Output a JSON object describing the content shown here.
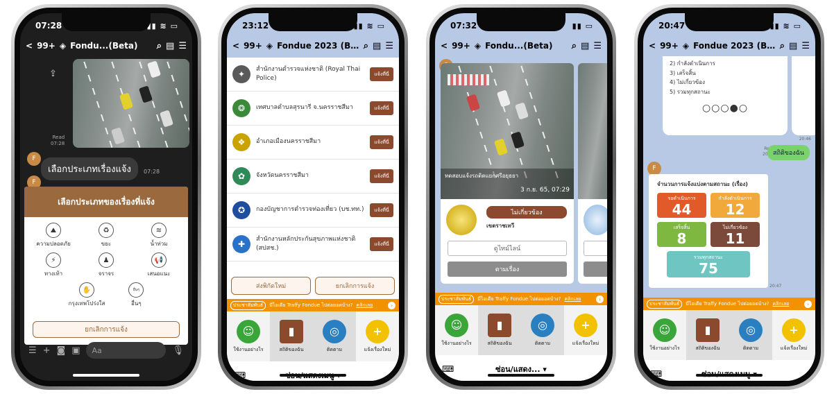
{
  "phone1": {
    "time": "07:28",
    "signal": "▮▮ ≋ ▭",
    "nav": {
      "back": "<",
      "count": "99+",
      "title": "Fondu...(Beta)"
    },
    "read": {
      "status": "Read",
      "time": "07:28"
    },
    "message": "เลือกประเภทเรื่องแจ้ง",
    "message_time": "07:28",
    "card_title": "เลือกประเภทของเรื่องที่แจ้ง",
    "categories": [
      {
        "label": "ความปลอดภัย",
        "icon": "⛰"
      },
      {
        "label": "ขยะ",
        "icon": "♻"
      },
      {
        "label": "น้ำท่วม",
        "icon": "≋"
      },
      {
        "label": "ทางเท้า",
        "icon": "⚡"
      },
      {
        "label": "จราจร",
        "icon": "♟"
      },
      {
        "label": "เสนอแนะ",
        "icon": "📢"
      },
      {
        "label": "กรุงเทพโปร่งใส",
        "icon": "✋"
      },
      {
        "label": "อื่นๆ",
        "icon": "อื่นๆ"
      }
    ],
    "cancel": "ยกเลิกการแจ้ง",
    "input_placeholder": "Aa"
  },
  "phone2": {
    "time": "23:12",
    "signal": "▮▮ ≋ ▭",
    "nav": {
      "back": "<",
      "count": "99+",
      "title": "Fondue 2023 (Beta)"
    },
    "agencies": [
      {
        "name": "สำนักงานตำรวจแห่งชาติ (Royal Thai Police)",
        "btn": "แจ้งที่นี่",
        "color": "#5a5a5a"
      },
      {
        "name": "เทศบาลตำบลสุรนารี จ.นครราชสีมา",
        "btn": "แจ้งที่นี่",
        "color": "#3a8a3a"
      },
      {
        "name": "อำเภอเมืองนครราชสีมา",
        "btn": "แจ้งที่นี่",
        "color": "#c9a300"
      },
      {
        "name": "จังหวัดนครราชสีมา",
        "btn": "แจ้งที่นี่",
        "color": "#2e8b57"
      },
      {
        "name": "กองบัญชาการตำรวจท่องเที่ยว (บช.ทท.)",
        "btn": "แจ้งที่นี่",
        "color": "#1f4e9e"
      },
      {
        "name": "สำนักงานหลักประกันสุขภาพแห่งชาติ (สปสช.)",
        "btn": "แจ้งที่นี่",
        "color": "#2a72c8"
      }
    ],
    "send_new": "ส่งพิกัดใหม่",
    "cancel": "ยกเลิกการแจ้ง",
    "promo": {
      "badge": "ประชาสัมพันธ์",
      "text": "มีไอเดีย Traffy Fondue ไปต่อยอดบ้าง?",
      "link": "คลิกเลย"
    },
    "tabs": [
      {
        "label": "ใช้งานอย่างไร",
        "icon": "☺",
        "color": "#3aa63a"
      },
      {
        "label": "สถิติของฉัน",
        "icon": "▮",
        "color": "#8b4a2e"
      },
      {
        "label": "ติดตาม",
        "icon": "◎",
        "color": "#2a7fc0"
      },
      {
        "label": "แจ้งเรื่องใหม่",
        "icon": "+",
        "color": "#f2c200"
      }
    ],
    "menu_toggle": "ซ่อน/แสดงเมนู ▾"
  },
  "phone3": {
    "time": "07:32",
    "signal": "▮▮ ▭",
    "nav": {
      "back": "<",
      "count": "99+",
      "title": "Fondu...(Beta)"
    },
    "caption": "ทดสอบแจ้งรถติดแยกศรีอยุธยา",
    "date": "3 ก.ย. 65, 07:29",
    "status": "ไม่เกี่ยวข้อง",
    "district": "เขตราชเทวี",
    "view_timeline": "ดูไทม์ไลน์",
    "follow": "ตามเรื่อง",
    "promo": {
      "badge": "ประชาสัมพันธ์",
      "text": "มีไอเดีย Traffy Fondue ไปต่อยอดบ้าง?",
      "link": "คลิกเลย"
    },
    "tabs": [
      {
        "label": "ใช้งานอย่างไร",
        "icon": "☺",
        "color": "#3aa63a"
      },
      {
        "label": "สถิติของฉัน",
        "icon": "▮",
        "color": "#8b4a2e"
      },
      {
        "label": "ติดตาม",
        "icon": "◎",
        "color": "#2a7fc0"
      },
      {
        "label": "แจ้งเรื่องใหม่",
        "icon": "+",
        "color": "#f2c200"
      }
    ],
    "menu_toggle": "ซ่อน/แสดง... ▾"
  },
  "phone4": {
    "time": "20:47",
    "signal": "▮▮ ≋ ▭",
    "nav": {
      "back": "<",
      "count": "99+",
      "title": "Fondue 2023 (Beta)"
    },
    "list": [
      "2) กำลังดำเนินการ",
      "3) เสร็จสิ้น",
      "4) ไม่เกี่ยวข้อง",
      "5) รวมทุกสถานะ"
    ],
    "carousel": "○○○●○",
    "time_a": "20:46",
    "read": {
      "status": "Read",
      "time": "20:47"
    },
    "my_stats": "สถิติของฉัน",
    "stats_title": "จำนวนการแจ้งแบ่งตามสถานะ (เรื่อง)",
    "stats": [
      {
        "label": "รอดำเนินการ",
        "value": "44",
        "color": "#e05a2a"
      },
      {
        "label": "กำลังดำเนินการ",
        "value": "12",
        "color": "#f2a93b"
      },
      {
        "label": "เสร็จสิ้น",
        "value": "8",
        "color": "#7fb841"
      },
      {
        "label": "ไม่เกี่ยวข้อง",
        "value": "11",
        "color": "#7b4a3a"
      }
    ],
    "total": {
      "label": "รวมทุกสถานะ",
      "value": "75",
      "color": "#6ec5c2"
    },
    "time_b": "20:47",
    "promo": {
      "badge": "ประชาสัมพันธ์",
      "text": "มีไอเดีย Traffy Fondue ไปต่อยอดบ้าง?",
      "link": "คลิกเลย"
    },
    "tabs": [
      {
        "label": "ใช้งานอย่างไร",
        "icon": "☺",
        "color": "#3aa63a"
      },
      {
        "label": "สถิติของฉัน",
        "icon": "▮",
        "color": "#8b4a2e"
      },
      {
        "label": "ติดตาม",
        "icon": "◎",
        "color": "#2a7fc0"
      },
      {
        "label": "แจ้งเรื่องใหม่",
        "icon": "+",
        "color": "#f2c200"
      }
    ],
    "menu_toggle": "ซ่อน/แสดงเมนู ▾"
  }
}
